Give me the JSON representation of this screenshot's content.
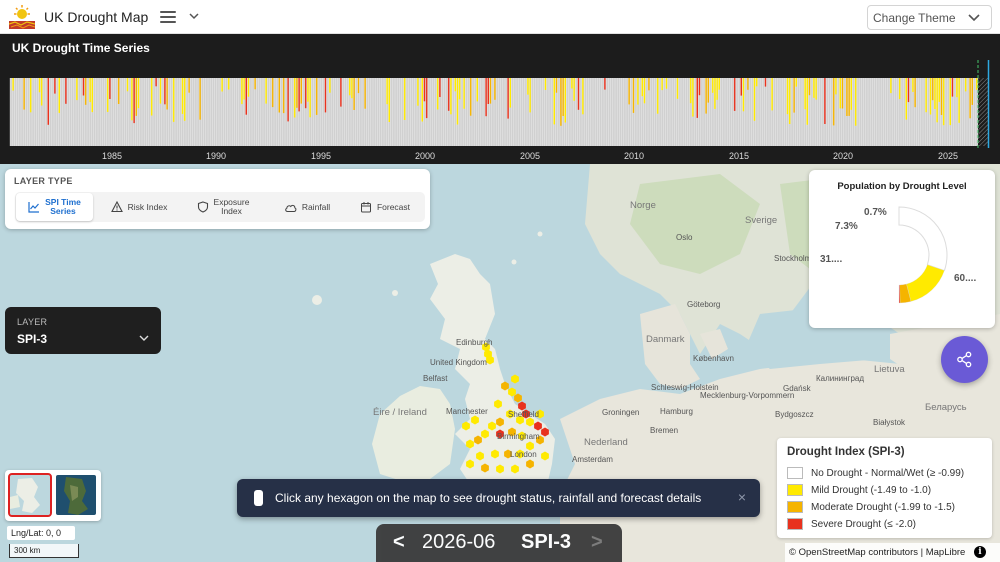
{
  "header": {
    "app_title": "UK Drought Map",
    "theme_label": "Change Theme"
  },
  "time_series": {
    "title": "UK Drought Time Series",
    "years": [
      "1985",
      "1990",
      "1995",
      "2000",
      "2005",
      "2010",
      "2015",
      "2020",
      "2025"
    ]
  },
  "layer_type": {
    "header": "LAYER TYPE",
    "tabs": [
      {
        "label_line1": "SPI Time",
        "label_line2": "Series",
        "icon": "line-chart-icon",
        "active": true
      },
      {
        "label_line1": "Risk Index",
        "label_line2": "",
        "icon": "warning-triangle-icon",
        "active": false
      },
      {
        "label_line1": "Exposure",
        "label_line2": "Index",
        "icon": "shield-icon",
        "active": false
      },
      {
        "label_line1": "Rainfall",
        "label_line2": "",
        "icon": "cloud-icon",
        "active": false
      },
      {
        "label_line1": "Forecast",
        "label_line2": "",
        "icon": "calendar-icon",
        "active": false
      }
    ]
  },
  "layer_select": {
    "header": "LAYER",
    "value": "SPI-3"
  },
  "map": {
    "coords": "Lng/Lat: 0, 0",
    "scale": "300 km",
    "labels": {
      "edinburgh": "Edinburgh",
      "united_kingdom": "United Kingdom",
      "belfast": "Belfast",
      "eire_ireland": "Éire / Ireland",
      "manchester": "Manchester",
      "sheffield": "Sheffield",
      "birmingham": "Birmingham",
      "london": "London",
      "danmark": "Danmark",
      "kobenhavn": "København",
      "goteborg": "Göteborg",
      "oslo": "Oslo",
      "stockholm": "Stockholm",
      "norge": "Norge",
      "sverige": "Sverige",
      "nederland": "Nederland",
      "amsterdam": "Amsterdam",
      "hamburg": "Hamburg",
      "groningen": "Groningen",
      "bremen": "Bremen",
      "schleswig_holstein": "Schleswig-Holstein",
      "mecklenburg": "Mecklenburg-Vorpommern",
      "gdansk": "Gdańsk",
      "bydgoszcz": "Bydgoszcz",
      "bialystok": "Białystok",
      "kaliningrad": "Калининград",
      "lietuva": "Lietuva",
      "belarus": "Беларусь"
    }
  },
  "population": {
    "title": "Population by Drought Level",
    "labels": {
      "severe": "0.7%",
      "moderate": "7.3%",
      "mild": "31....",
      "none": "60...."
    },
    "values": {
      "none": 60.5,
      "mild": 31.5,
      "moderate": 7.3,
      "severe": 0.7
    }
  },
  "legend": {
    "title": "Drought Index (SPI-3)",
    "items": [
      {
        "label": "No Drought - Normal/Wet (≥ -0.99)",
        "color": "#ffffff"
      },
      {
        "label": "Mild Drought (-1.49 to -1.0)",
        "color": "#ffea00"
      },
      {
        "label": "Moderate Drought (-1.99 to -1.5)",
        "color": "#f5b400"
      },
      {
        "label": "Severe Drought (≤ -2.0)",
        "color": "#e8321e"
      }
    ]
  },
  "attribution": "© OpenStreetMap contributors | MapLibre",
  "toast": {
    "message": "Click any hexagon on the map to see drought status, rainfall and forecast details",
    "close": "×"
  },
  "datebar": {
    "prev": "<",
    "date": "2026-06",
    "index": "SPI-3",
    "next": ">"
  }
}
